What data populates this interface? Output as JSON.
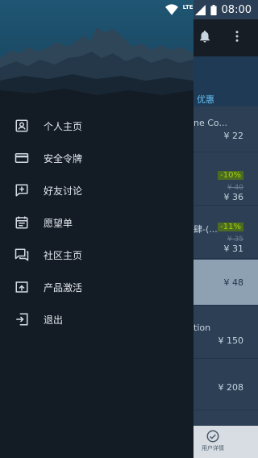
{
  "status_bar": {
    "network": "LTE",
    "time": "08:00"
  },
  "background_app": {
    "tab_visible": "优惠",
    "rows": [
      {
        "name": "ne Co...",
        "price": "¥ 22",
        "sub": "...",
        "discount": "",
        "old_price": ""
      },
      {
        "name": "",
        "price": "¥ 36",
        "sub": "",
        "discount": "-10%",
        "old_price": "¥ 40"
      },
      {
        "name": "肆-(...",
        "price": "¥ 31",
        "sub": "",
        "discount": "-11%",
        "old_price": "¥ 35"
      },
      {
        "name": "",
        "price": "¥ 48",
        "sub": "",
        "discount": "",
        "old_price": ""
      },
      {
        "name": "tion",
        "price": "¥ 150",
        "sub": "",
        "discount": "",
        "old_price": ""
      },
      {
        "name": "",
        "price": "¥ 208",
        "sub": "",
        "discount": "",
        "old_price": ""
      }
    ],
    "bottom_nav_label": "用户详情"
  },
  "drawer": {
    "items": [
      {
        "label": "个人主页",
        "icon": "account-box-icon"
      },
      {
        "label": "安全令牌",
        "icon": "credit-card-icon"
      },
      {
        "label": "好友讨论",
        "icon": "add-comment-icon"
      },
      {
        "label": "愿望单",
        "icon": "calendar-list-icon"
      },
      {
        "label": "社区主页",
        "icon": "forum-icon"
      },
      {
        "label": "产品激活",
        "icon": "upload-box-icon"
      },
      {
        "label": "退出",
        "icon": "logout-icon"
      }
    ]
  },
  "colors": {
    "drawer_bg": "#131b24",
    "accent": "#67c1f5",
    "discount_bg": "#4c6b22",
    "discount_text": "#a4d007"
  }
}
